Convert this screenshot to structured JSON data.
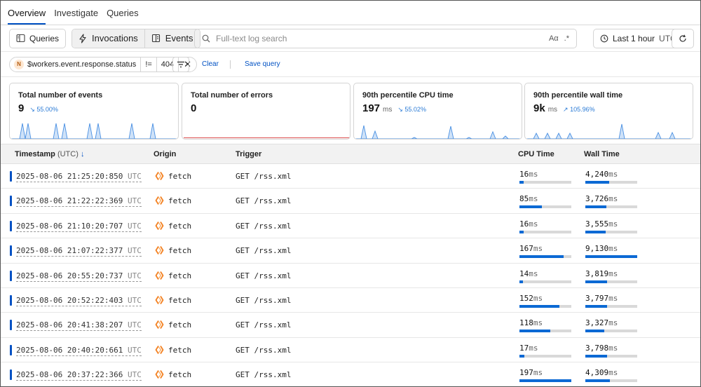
{
  "nav": {
    "tabs": [
      "Overview",
      "Investigate",
      "Queries"
    ],
    "active": 0
  },
  "toolbar": {
    "queries_label": "Queries",
    "invocations_label": "Invocations",
    "events_label": "Events",
    "search_placeholder": "Full-text log search",
    "case_option": "Aα",
    "regex_option": ".*",
    "time_range": "Last 1 hour",
    "timezone": "UTC"
  },
  "filter": {
    "badge": "N",
    "field": "$workers.event.response.status",
    "operator": "!=",
    "value": "404",
    "clear_label": "Clear",
    "save_label": "Save query"
  },
  "cards": [
    {
      "title": "Total number of events",
      "value": "9",
      "unit": "",
      "change": "↘ 55.00%"
    },
    {
      "title": "Total number of errors",
      "value": "0",
      "unit": "",
      "change": ""
    },
    {
      "title": "90th percentile CPU time",
      "value": "197",
      "unit": "ms",
      "change": "↘ 55.02%"
    },
    {
      "title": "90th percentile wall time",
      "value": "9k",
      "unit": "ms",
      "change": "↗ 105.96%"
    }
  ],
  "table": {
    "headers": {
      "timestamp": "Timestamp",
      "timestamp_tz": "(UTC)",
      "origin": "Origin",
      "trigger": "Trigger",
      "cpu": "CPU Time",
      "wall": "Wall Time"
    },
    "unit": "ms",
    "tz": "UTC",
    "rows": [
      {
        "timestamp": "2025-08-06 21:25:20:850",
        "origin": "fetch",
        "trigger": "GET /rss.xml",
        "cpu": "16",
        "cpu_frac": 0.08,
        "wall": "4,240",
        "wall_frac": 0.46
      },
      {
        "timestamp": "2025-08-06 21:22:22:369",
        "origin": "fetch",
        "trigger": "GET /rss.xml",
        "cpu": "85",
        "cpu_frac": 0.43,
        "wall": "3,726",
        "wall_frac": 0.41
      },
      {
        "timestamp": "2025-08-06 21:10:20:707",
        "origin": "fetch",
        "trigger": "GET /rss.xml",
        "cpu": "16",
        "cpu_frac": 0.08,
        "wall": "3,555",
        "wall_frac": 0.39
      },
      {
        "timestamp": "2025-08-06 21:07:22:377",
        "origin": "fetch",
        "trigger": "GET /rss.xml",
        "cpu": "167",
        "cpu_frac": 0.85,
        "wall": "9,130",
        "wall_frac": 1.0
      },
      {
        "timestamp": "2025-08-06 20:55:20:737",
        "origin": "fetch",
        "trigger": "GET /rss.xml",
        "cpu": "14",
        "cpu_frac": 0.07,
        "wall": "3,819",
        "wall_frac": 0.42
      },
      {
        "timestamp": "2025-08-06 20:52:22:403",
        "origin": "fetch",
        "trigger": "GET /rss.xml",
        "cpu": "152",
        "cpu_frac": 0.77,
        "wall": "3,797",
        "wall_frac": 0.42
      },
      {
        "timestamp": "2025-08-06 20:41:38:207",
        "origin": "fetch",
        "trigger": "GET /rss.xml",
        "cpu": "118",
        "cpu_frac": 0.6,
        "wall": "3,327",
        "wall_frac": 0.36
      },
      {
        "timestamp": "2025-08-06 20:40:20:661",
        "origin": "fetch",
        "trigger": "GET /rss.xml",
        "cpu": "17",
        "cpu_frac": 0.09,
        "wall": "3,798",
        "wall_frac": 0.42
      },
      {
        "timestamp": "2025-08-06 20:37:22:366",
        "origin": "fetch",
        "trigger": "GET /rss.xml",
        "cpu": "197",
        "cpu_frac": 1.0,
        "wall": "4,309",
        "wall_frac": 0.47
      }
    ]
  },
  "colors": {
    "accent": "#0051c3",
    "bar": "#0b69d4",
    "spark_fill": "#cfe2f8",
    "spark_line": "#4a90e2",
    "error_line": "#e06666",
    "origin_icon": "#f38020"
  }
}
